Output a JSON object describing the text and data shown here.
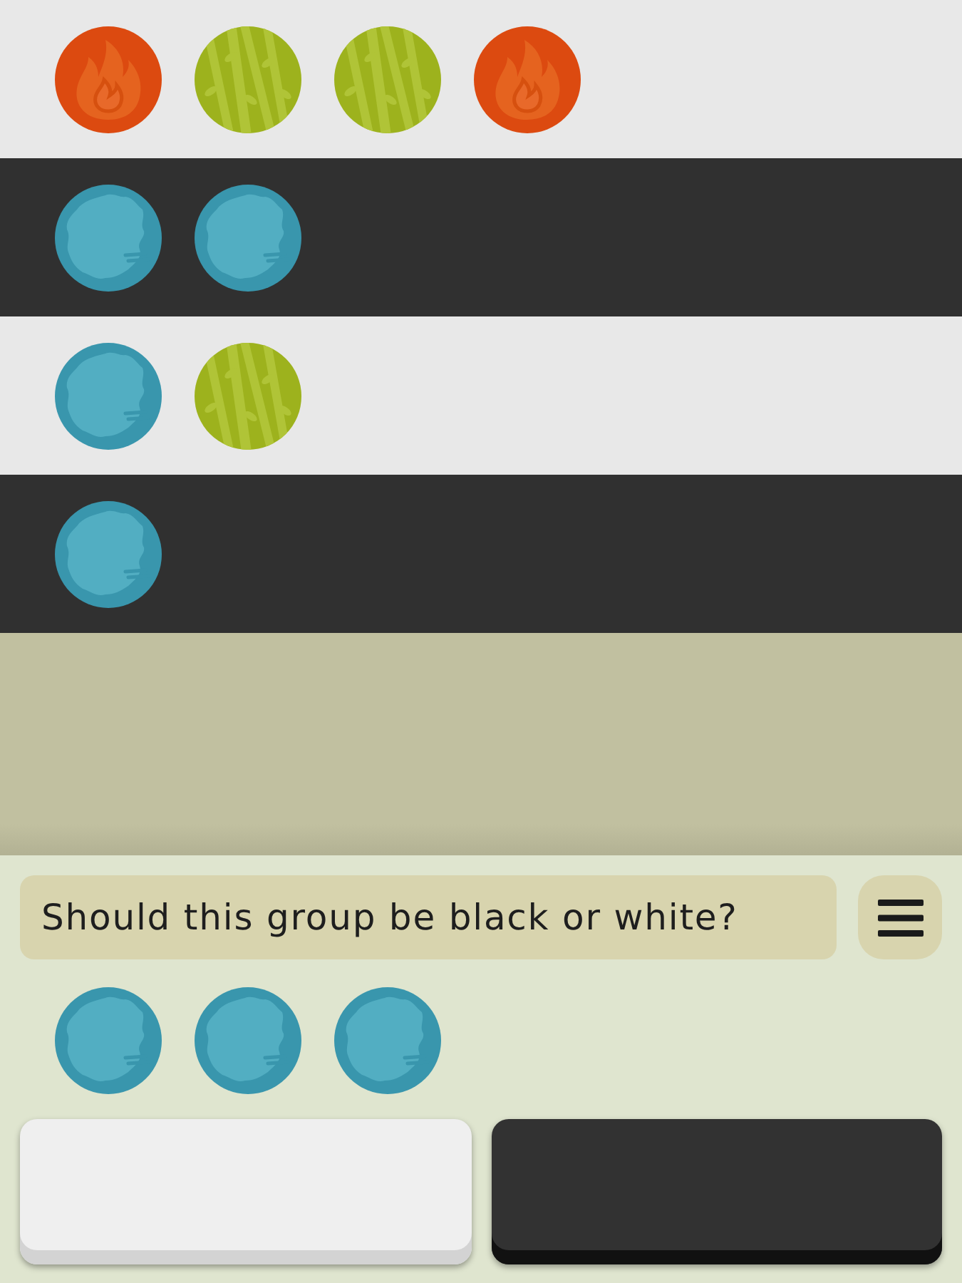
{
  "board": {
    "rows": [
      {
        "kind": "white",
        "tokens": [
          {
            "kind": "fire"
          },
          {
            "kind": "plant"
          },
          {
            "kind": "plant"
          },
          {
            "kind": "fire"
          }
        ]
      },
      {
        "kind": "black",
        "tokens": [
          {
            "kind": "water"
          },
          {
            "kind": "water"
          }
        ]
      },
      {
        "kind": "white",
        "tokens": [
          {
            "kind": "water"
          },
          {
            "kind": "plant"
          }
        ]
      },
      {
        "kind": "black",
        "tokens": [
          {
            "kind": "water"
          }
        ]
      }
    ]
  },
  "panel": {
    "question": "Should this group be black or white?",
    "current_group": [
      {
        "kind": "water"
      },
      {
        "kind": "water"
      },
      {
        "kind": "water"
      }
    ],
    "answer_buttons": [
      {
        "kind": "white"
      },
      {
        "kind": "black"
      }
    ]
  }
}
